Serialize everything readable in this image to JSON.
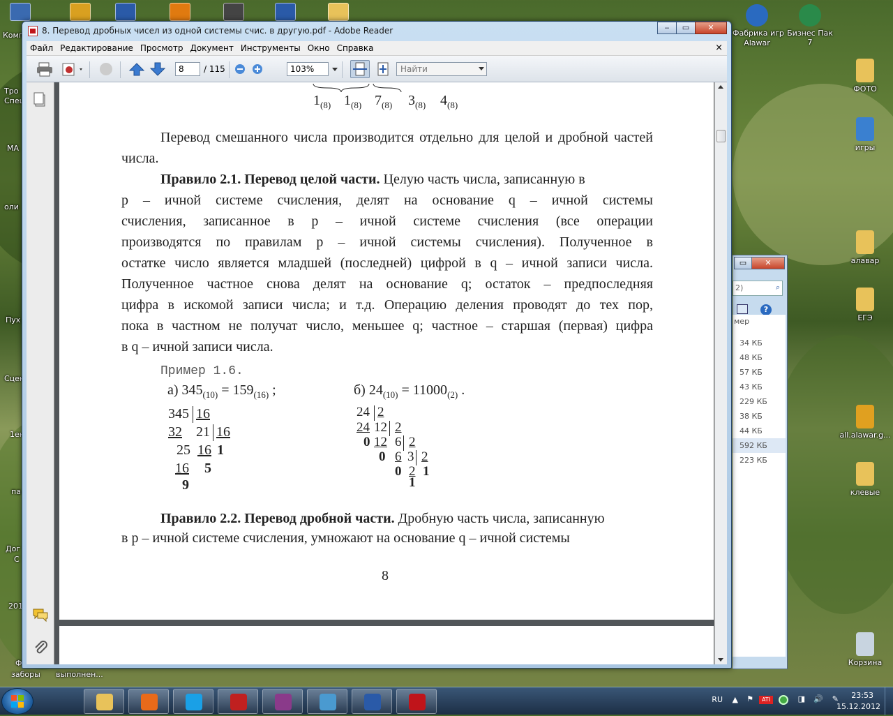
{
  "desktop": {
    "top_icons": [
      {
        "label": "Компьютер",
        "icon": "computer-icon",
        "color": "#3a6ab0"
      },
      {
        "label": "",
        "icon": "app-icon",
        "color": "#d9a020"
      },
      {
        "label": "",
        "icon": "word-doc-icon",
        "color": "#2a5aa8"
      },
      {
        "label": "",
        "icon": "orange-app-icon",
        "color": "#e07a10"
      },
      {
        "label": "",
        "icon": "film-icon",
        "color": "#444"
      },
      {
        "label": "",
        "icon": "word-doc-icon",
        "color": "#2a5aa8"
      },
      {
        "label": "",
        "icon": "folder-icon",
        "color": "#e8c25a"
      }
    ],
    "right_top": [
      {
        "label": "Фабрика игр\nAlawar",
        "icon": "game-factory-icon",
        "color": "#2a6ac0"
      },
      {
        "label": "Бизнес Пак 7",
        "icon": "business-pack-icon",
        "color": "#2a8a4a"
      }
    ],
    "right_column": [
      {
        "label": "ФОТО",
        "icon": "folder-icon",
        "color": "#e8c25a"
      },
      {
        "label": "игры",
        "icon": "games-icon",
        "color": "#3a80d0"
      },
      {
        "label": "алавар",
        "icon": "folder-icon",
        "color": "#e8c25a"
      },
      {
        "label": "ЕГЭ",
        "icon": "folder-icon",
        "color": "#e8c25a"
      },
      {
        "label": "all.alawar.g...",
        "icon": "key-icon",
        "color": "#e0a020"
      },
      {
        "label": "клевые",
        "icon": "folder-icon",
        "color": "#e8c25a"
      },
      {
        "label": "Корзина",
        "icon": "recycle-bin-icon",
        "color": "#c8d4e0"
      }
    ],
    "left_fragments": [
      "Тро",
      "Спец",
      "МА",
      "оли",
      "Пух",
      "Сцен",
      "1ен",
      "па",
      "Дог",
      "С",
      "201",
      "Ф",
      "заборы",
      "выполнен..."
    ]
  },
  "window": {
    "title": "8. Перевод дробных чисел из одной системы счис. в другую.pdf - Adobe Reader",
    "buttons": [
      "‒",
      "▭",
      "✕"
    ],
    "menu": [
      "Файл",
      "Редактирование",
      "Просмотр",
      "Документ",
      "Инструменты",
      "Окно",
      "Справка"
    ],
    "menu_close": "×",
    "page_current": "8",
    "page_total": "/ 115",
    "zoom": "103%",
    "search_placeholder": "Найти"
  },
  "document": {
    "top_digits": [
      "1",
      "1",
      "7",
      "3",
      "4"
    ],
    "top_sub": "(8)",
    "para1": "Перевод смешанного числа производится отдельно для целой и дробной частей числа.",
    "rule1_bold": "Правило 2.1. Перевод целой части.",
    "rule1_line1": "Целую часть числа, записанную в",
    "rule1_lines": [
      "p – ичной системе счисления, делят на основание q – ичной системы",
      "счисления, записанное в p – ичной системе счисления (все операции",
      "производятся по правилам p – ичной системы счисления). Полученное в",
      "остатке число является младшей (последней) цифрой в q – ичной записи числа.",
      "Полученное частное снова делят на основание q; остаток – предпоследняя",
      "цифра в искомой записи числа; и т.д. Операцию деления проводят до тех пор,",
      "пока в частном не получат число, меньшее q; частное – старшая (первая) цифра",
      "в q – ичной записи числа."
    ],
    "example_title": "Пример 1.6.",
    "example_a": "а) 345(10) = 159(16) ;",
    "example_b": "б) 24(10) = 11000(2) .",
    "rule2_bold": "Правило 2.2. Перевод дробной части.",
    "rule2_line1": "Дробную часть числа, записанную",
    "rule2_line2": "в p – ичной системе счисления, умножают на основание q – ичной системы",
    "page_number": "8"
  },
  "explorer": {
    "search_hint": "2)",
    "column_label": "мер",
    "sizes": [
      "34 КБ",
      "48 КБ",
      "57 КБ",
      "43 КБ",
      "229 КБ",
      "38 КБ",
      "44 КБ",
      "592 КБ",
      "223 КБ"
    ],
    "selected_index": 7
  },
  "taskbar": {
    "apps": [
      "explorer-folder",
      "firefox",
      "skype",
      "alawar",
      "winrar",
      "photo-viewer",
      "word",
      "adobe-reader"
    ],
    "lang": "RU",
    "time": "23:53",
    "date": "15.12.2012"
  }
}
